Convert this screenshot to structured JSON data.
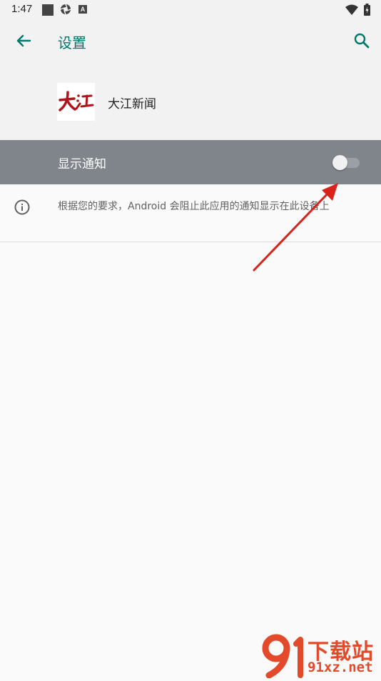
{
  "status_bar": {
    "time": "1:47",
    "icons": [
      "stop-square-icon",
      "camera-aperture-icon",
      "a-letter-icon",
      "wifi-icon",
      "battery-icon"
    ],
    "a_letter": "A"
  },
  "app_bar": {
    "title": "设置",
    "back_icon": "arrow-left-icon",
    "search_icon": "search-icon",
    "accent_color": "#00796b"
  },
  "app_header": {
    "name": "大江新闻",
    "logo_text": "大江",
    "logo_color": "#b0141a"
  },
  "notification_setting": {
    "label": "显示通知",
    "enabled": false
  },
  "info": {
    "icon": "info-circle-icon",
    "text": "根据您的要求，Android 会阻止此应用的通知显示在此设备上"
  },
  "watermark": {
    "line1": "下载站",
    "line2": "91xz.net",
    "color": "#e24a2b"
  }
}
